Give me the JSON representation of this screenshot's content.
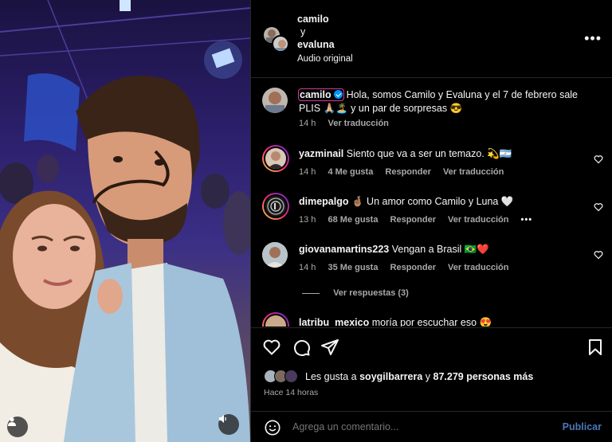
{
  "header": {
    "user1": "camilo",
    "connector": "y",
    "user2": "evaluna",
    "audio": "Audio original",
    "more_icon": "more-horizontal-icon"
  },
  "caption": {
    "username": "camilo",
    "text": "Hola, somos Camilo y Evaluna y el 7 de febrero sale PLIS 🙏🏼🏝️ y un par de sorpresas 😎",
    "time": "14 h",
    "translate": "Ver traducción"
  },
  "comments": [
    {
      "username": "yazminail",
      "text": "Siento que va a ser un temazo. 💫🇦🇷",
      "time": "14 h",
      "likes": "4 Me gusta",
      "reply": "Responder",
      "translate": "Ver traducción"
    },
    {
      "username": "dimepalgo",
      "text": "🤞🏽 Un amor como Camilo y Luna 🤍",
      "time": "13 h",
      "likes": "68 Me gusta",
      "reply": "Responder",
      "translate": "Ver traducción",
      "more": "•••"
    },
    {
      "username": "giovanamartins223",
      "text": "Vengan a Brasil 🇧🇷❤️",
      "time": "14 h",
      "likes": "35 Me gusta",
      "reply": "Responder",
      "translate": "Ver traducción",
      "view_replies": "Ver respuestas (3)"
    },
    {
      "username": "latribu_mexico",
      "text": "moría por escuchar eso 😍"
    }
  ],
  "actions": {
    "like_icon": "heart-icon",
    "comment_icon": "comment-icon",
    "share_icon": "send-icon",
    "save_icon": "bookmark-icon"
  },
  "likes": {
    "prefix": "Les gusta a ",
    "user": "soygilbarrera",
    "middle": " y ",
    "count": "87.279 personas más"
  },
  "posted": "Hace 14 horas",
  "composer": {
    "placeholder": "Agrega un comentario...",
    "post_label": "Publicar",
    "emoji_icon": "smiley-icon"
  },
  "media": {
    "profile_icon": "user-icon",
    "audio_icon": "speaker-icon"
  }
}
